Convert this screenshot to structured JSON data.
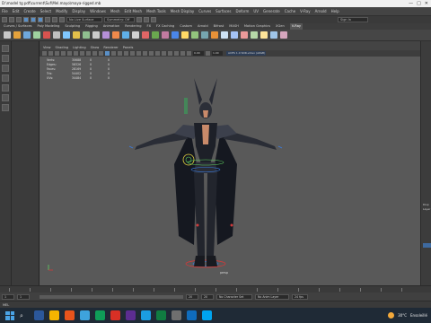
{
  "window": {
    "title": "D:\\model tg pdf\\current\\Suf\\Mel.mayo\\maya-rigged.mb",
    "controls": [
      "—",
      "□",
      "✕"
    ]
  },
  "menus": [
    "File",
    "Edit",
    "Create",
    "Select",
    "Modify",
    "Display",
    "Windows",
    "Mesh",
    "Edit Mesh",
    "Mesh Tools",
    "Mesh Display",
    "Curves",
    "Surfaces",
    "Deform",
    "UV",
    "Generate",
    "Cache",
    "V-Ray",
    "Arnold",
    "Help"
  ],
  "statusline": {
    "no_live_surface": "No Live Surface",
    "symmetry": "Symmetry: Off",
    "sign_in": "Sign In"
  },
  "shelf_tabs": [
    "Curves / Surfaces",
    "Poly Modeling",
    "Sculpting",
    "Rigging",
    "Animation",
    "Rendering",
    "FX",
    "FX Caching",
    "Custom",
    "Arnold",
    "Bifrost",
    "MASH",
    "Motion Graphics",
    "XGen",
    "V-Ray"
  ],
  "shelf_active": "V-Ray",
  "shelf_colors": [
    "#c9c9c9",
    "#e4a23c",
    "#6fa8dc",
    "#9fd19f",
    "#d9534f",
    "#c0c0c0",
    "#7fc7ff",
    "#e3c04a",
    "#8fbf8f",
    "#cccccc",
    "#b58fd6",
    "#f08a4b",
    "#5fb0e8",
    "#d0d0d0",
    "#e06666",
    "#6aa84f",
    "#c27ba0",
    "#4a86e8",
    "#ffd966",
    "#93c47d",
    "#76a5af",
    "#e69138",
    "#cfe2f3",
    "#a4c2f4",
    "#ea9999",
    "#b6d7a8",
    "#ffe599",
    "#9fc5e8",
    "#d5a6bd"
  ],
  "viewport": {
    "menu": [
      "View",
      "Shading",
      "Lighting",
      "Show",
      "Renderer",
      "Panels"
    ],
    "near_clip": "0.00",
    "far_clip": "1.00",
    "color_space": "ACES 1.0 SDR-video (sRGB)",
    "camera_label": "persp"
  },
  "hud": {
    "rows": [
      {
        "label": "Verts:",
        "a": "30688",
        "b": "0",
        "c": "0"
      },
      {
        "label": "Edges:",
        "a": "58326",
        "b": "0",
        "c": "0"
      },
      {
        "label": "Faces:",
        "a": "28169",
        "b": "0",
        "c": "0"
      },
      {
        "label": "Tris:",
        "a": "54402",
        "b": "0",
        "c": "0"
      },
      {
        "label": "UVs:",
        "a": "34484",
        "b": "0",
        "c": "0"
      }
    ]
  },
  "right_panel": {
    "label1": "Disp",
    "label2": "Layer"
  },
  "range": {
    "start": "1",
    "start_inner": "1",
    "end_inner": "20",
    "end": "20",
    "char_set": "No Character Set",
    "anim_layer": "No Anim Layer",
    "fps": "24 fps"
  },
  "cmdline": {
    "label": "MEL"
  },
  "taskbar": {
    "app_colors": [
      "#2b579a",
      "#f4b400",
      "#e8541c",
      "#3ea3dc",
      "#0f9d58",
      "#d93025",
      "#5c2d91",
      "#1b9de2",
      "#107c41",
      "#6f6f6f",
      "#0f6cbd",
      "#00a4ef"
    ],
    "temperature": "30°C",
    "weather_text": "Ensoleillé"
  }
}
